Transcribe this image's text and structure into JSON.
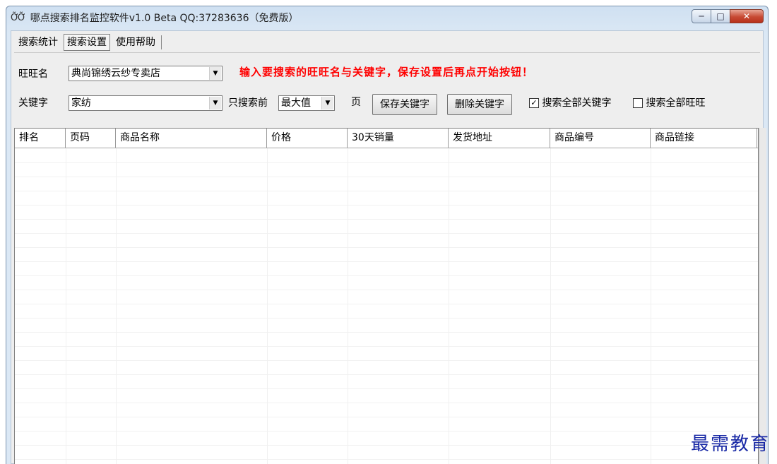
{
  "window": {
    "app_icon": "ỠỠ",
    "title": "哪点搜索排名监控软件v1.0 Beta QQ:37283636（免费版）",
    "min_label": "─",
    "max_label": "□",
    "close_label": "✕"
  },
  "tabs": [
    "搜索统计",
    "搜索设置",
    "使用帮助"
  ],
  "form": {
    "wangwang_label": "旺旺名",
    "wangwang_value": "典尚锦绣云纱专卖店",
    "keyword_label": "关键字",
    "keyword_value": "家纺",
    "hint": "输入要搜索的旺旺名与关键字，保存设置后再点开始按钮！",
    "only_search_label": "只搜索前",
    "pages_value": "最大值",
    "page_unit": "页",
    "save_button": "保存关键字",
    "delete_button": "删除关键字",
    "search_all_keywords_checked": true,
    "search_all_keywords_label": "搜索全部关键字",
    "search_all_wangwang_checked": false,
    "search_all_wangwang_label": "搜索全部旺旺"
  },
  "table": {
    "columns": [
      "排名",
      "页码",
      "商品名称",
      "价格",
      "30天销量",
      "发货地址",
      "商品编号",
      "商品链接"
    ]
  },
  "watermark": "最需教育"
}
